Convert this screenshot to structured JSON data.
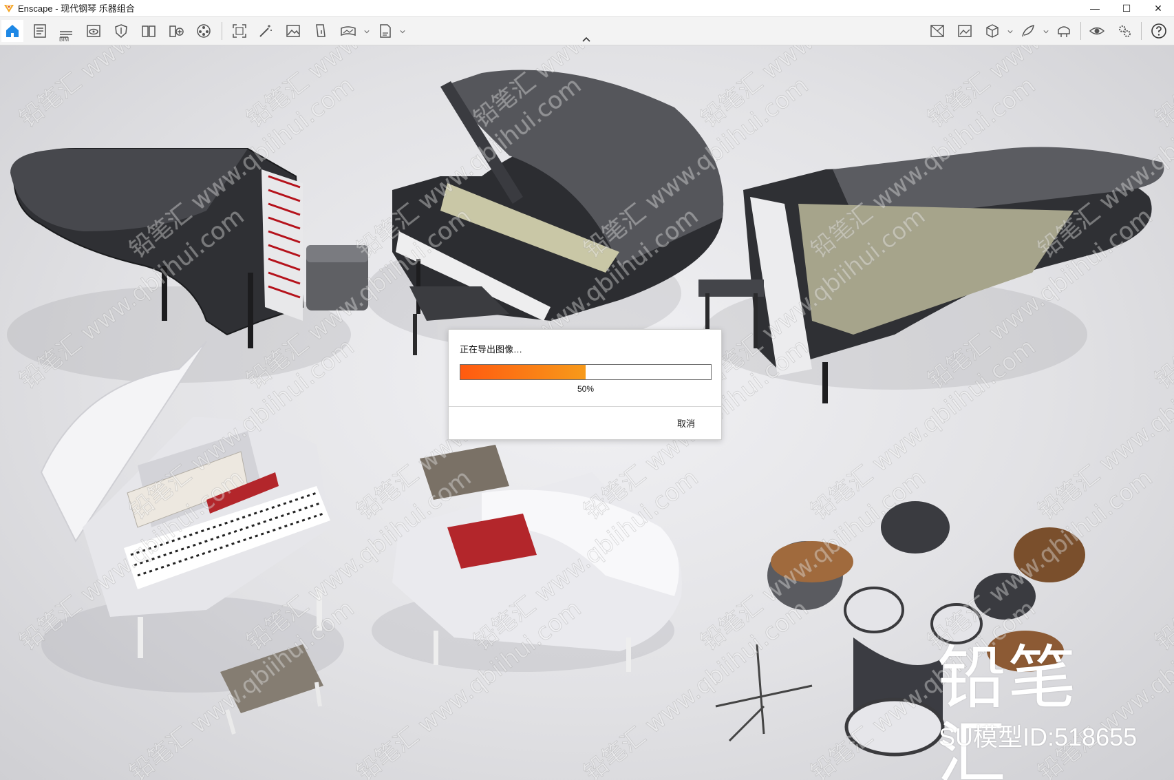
{
  "window": {
    "title": "Enscape - 现代钢琴 乐器组合",
    "controls": {
      "minimize": "—",
      "maximize": "☐",
      "close": "✕"
    }
  },
  "toolbar": {
    "left_tools": [
      "home-icon",
      "document-icon",
      "bim-list-icon",
      "view-eye-icon",
      "shield-icon",
      "book-icon",
      "book-plus-icon",
      "reel-icon",
      "screenshot-icon",
      "magic-wand-icon",
      "image-icon",
      "paint-bucket-icon",
      "panorama-360-icon",
      "export-exe-icon"
    ],
    "bim_label": "BIM",
    "right_tools": [
      "image-box-icon",
      "gallery-icon",
      "cube-icon",
      "feather-icon",
      "vr-headset-icon",
      "eye-icon",
      "settings-icon",
      "help-icon"
    ],
    "active_tool": "home-icon",
    "accent_color": "#1e88e5"
  },
  "dialog": {
    "message": "正在导出图像…",
    "progress": 0.5,
    "progress_label": "50%",
    "cancel_label": "取消",
    "fill_color_start": "#ff5a10",
    "fill_color_end": "#f79a1a"
  },
  "brand": {
    "logo_text": "铅笔汇",
    "id_text": "SU模型ID:518655"
  },
  "watermark": {
    "text": "铅笔汇 www.qbiihui.com"
  }
}
